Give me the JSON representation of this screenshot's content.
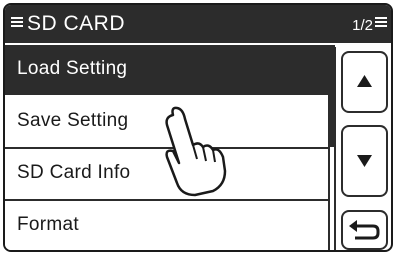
{
  "title_bar": {
    "title": "SD CARD",
    "page_indicator": "1/2"
  },
  "menu": {
    "items": [
      {
        "label": "Load Setting",
        "selected": true
      },
      {
        "label": "Save Setting",
        "selected": false
      },
      {
        "label": "SD Card Info",
        "selected": false
      },
      {
        "label": "Format",
        "selected": false
      }
    ]
  },
  "side_buttons": {
    "up": "up-arrow-icon",
    "down": "down-arrow-icon",
    "back": "return-arrow-icon"
  },
  "colors": {
    "bar": "#2c2c2c",
    "text_dark": "#1a1a1a",
    "text_light": "#ffffff",
    "background": "#ffffff"
  }
}
